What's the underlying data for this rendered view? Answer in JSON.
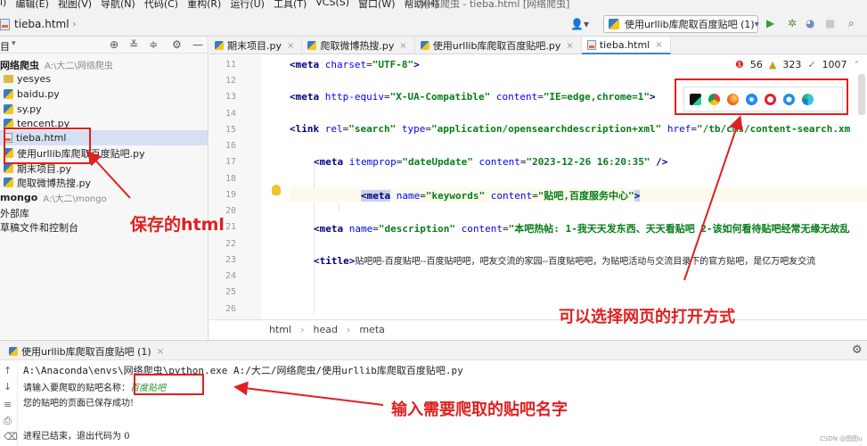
{
  "menubar": {
    "items": [
      "l)",
      "编辑(E)",
      "视图(V)",
      "导航(N)",
      "代码(C)",
      "重构(R)",
      "运行(U)",
      "工具(T)",
      "VCS(S)",
      "窗口(W)",
      "帮助(H)"
    ],
    "window_title": "网络爬虫 - tieba.html [网络爬虫]"
  },
  "navbar": {
    "file": "tieba.html",
    "run_config": "使用urllib库爬取百度贴吧 (1)"
  },
  "project": {
    "header_label": "目",
    "tree": [
      {
        "label": "网络爬虫",
        "path": "A:\\大二\\网络爬虫",
        "type": "root"
      },
      {
        "label": "yesyes",
        "type": "folder"
      },
      {
        "label": "baidu.py",
        "type": "py"
      },
      {
        "label": "sy.py",
        "type": "py"
      },
      {
        "label": "tencent.py",
        "type": "py"
      },
      {
        "label": "tieba.html",
        "type": "html"
      },
      {
        "label": "使用urllib库爬取百度贴吧.py",
        "type": "py"
      },
      {
        "label": "期末项目.py",
        "type": "py"
      },
      {
        "label": "爬取微博热搜.py",
        "type": "py"
      },
      {
        "label": "mongo",
        "path": "A:\\大二\\mongo",
        "type": "root"
      },
      {
        "label": "外部库",
        "type": "plain"
      },
      {
        "label": "草稿文件和控制台",
        "type": "plain"
      }
    ]
  },
  "editor": {
    "tabs": [
      {
        "label": "期末项目.py"
      },
      {
        "label": "爬取微博热搜.py"
      },
      {
        "label": "使用urllib库爬取百度贴吧.py"
      },
      {
        "label": "tieba.html"
      }
    ],
    "line_numbers": [
      "11",
      "12",
      "13",
      "14",
      "15",
      "16",
      "17",
      "18",
      "19",
      "20",
      "21",
      "22",
      "23",
      "24",
      "25",
      "26"
    ],
    "inspection": {
      "errors": "56",
      "warnings": "323",
      "ok": "1007"
    },
    "breadcrumbs": [
      "html",
      "head",
      "meta"
    ],
    "code": {
      "l11": {
        "tag": "<meta",
        "a1": "charset",
        "v1": "\"UTF-8\"",
        "end": ">"
      },
      "l13": {
        "tag": "<meta",
        "a1": "http-equiv",
        "v1": "\"X-UA-Compatible\"",
        "a2": "content",
        "v2": "\"IE=edge,chrome=1\"",
        "end": ">"
      },
      "l15": {
        "tag": "<link",
        "a1": "rel",
        "v1": "\"search\"",
        "a2": "type",
        "v2": "\"application/opensearchdescription+xml\"",
        "a3": "href",
        "v3": "\"/tb/cms/content-search.xm"
      },
      "l17": {
        "tag": "<meta",
        "a1": "itemprop",
        "v1": "\"dateUpdate\"",
        "a2": "content",
        "v2": "\"2023-12-26 16:20:35\"",
        "end": " />"
      },
      "l19": {
        "tag": "<meta",
        "a1": "name",
        "v1": "\"keywords\"",
        "a2": "content",
        "v2": "\"贴吧,百度服务中心\"",
        "end": ">"
      },
      "l21": {
        "tag": "<meta",
        "a1": "name",
        "v1": "\"description\"",
        "a2": "content",
        "v2": "\"本吧热帖: 1-我天天发东西、天天看贴吧 2-该如何看待贴吧经常无缘无故乱"
      },
      "l23": {
        "tag": "<title>",
        "text": "贴吧吧-百度贴吧--百度贴吧吧，吧友交流的家园--百度贴吧吧，为贴吧活动与交流目录下的官方贴吧，是亿万吧友交流"
      }
    }
  },
  "run": {
    "title": "使用urllib库爬取百度贴吧 (1)",
    "lines": {
      "cmd": "A:\\Anaconda\\envs\\网络爬虫\\python.exe A:/大二/网络爬虫/使用urllib库爬取百度贴吧.py",
      "prompt": "请输入要爬取的贴吧名称：",
      "input": "百度贴吧",
      "saved": "您的贴吧的页面已保存成功!",
      "exit": "进程已结束，退出代码为 0"
    }
  },
  "annotations": {
    "saved_html": "保存的html",
    "open_method": "可以选择网页的打开方式",
    "input_name": "输入需要爬取的贴吧名字"
  },
  "watermark": "CSDN @图图u",
  "colors": {
    "annotation": "#e02020",
    "accent": "#4083c9"
  }
}
